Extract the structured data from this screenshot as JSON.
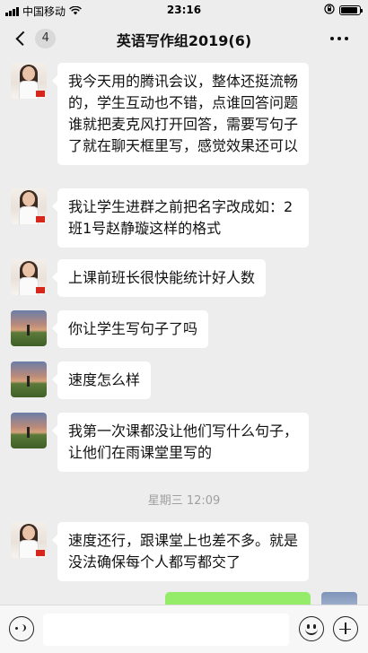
{
  "status_bar": {
    "carrier": "中国移动",
    "time": "23:16"
  },
  "nav": {
    "unread_count": "4",
    "title": "英语写作组2019(6)"
  },
  "messages": [
    {
      "sender": "a",
      "text": "我今天用的腾讯会议，整体还挺流畅的，学生互动也不错，点谁回答问题谁就把麦克风打开回答，需要写句子了就在聊天框里写，感觉效果还可以"
    },
    {
      "sender": "a",
      "text": "我让学生进群之前把名字改成如：2班1号赵静璇这样的格式"
    },
    {
      "sender": "a",
      "text": "上课前班长很快能统计好人数"
    },
    {
      "sender": "b",
      "text": "你让学生写句子了吗"
    },
    {
      "sender": "b",
      "text": "速度怎么样"
    },
    {
      "sender": "b",
      "text": "我第一次课都没让他们写什么句子，让他们在雨课堂里写的"
    },
    {
      "sender": "a",
      "text": "速度还行，跟课堂上也差不多。就是没法确保每个人都写都交了"
    }
  ],
  "timestamp": "星期三 12:09",
  "icons": {
    "back": "chevron-left-icon",
    "more": "more-dots-icon",
    "voice": "voice-icon",
    "emoji": "emoji-icon",
    "plus": "plus-icon"
  }
}
